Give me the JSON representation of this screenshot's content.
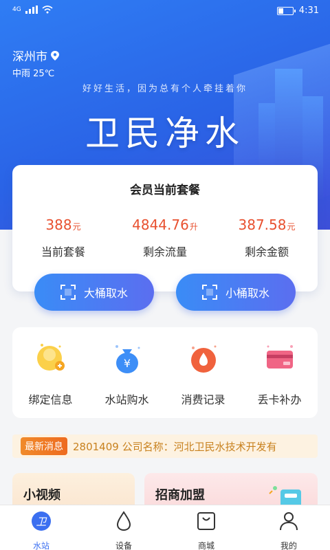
{
  "status": {
    "time": "4:31",
    "network": "4G"
  },
  "header": {
    "city": "深州市",
    "weather": "中雨 25℃",
    "slogan": "好好生活，因为总有个人牵挂着你",
    "title": "卫民净水"
  },
  "package": {
    "title": "会员当前套餐",
    "stats": [
      {
        "value": "388",
        "unit": "元",
        "label": "当前套餐"
      },
      {
        "value": "4844.76",
        "unit": "升",
        "label": "剩余流量"
      },
      {
        "value": "387.58",
        "unit": "元",
        "label": "剩余金额"
      }
    ],
    "buttons": {
      "big": "大桶取水",
      "small": "小桶取水"
    }
  },
  "menu": [
    {
      "label": "绑定信息",
      "icon": "bind-info-icon"
    },
    {
      "label": "水站购水",
      "icon": "money-bag-icon"
    },
    {
      "label": "消费记录",
      "icon": "water-drop-record-icon"
    },
    {
      "label": "丢卡补办",
      "icon": "card-icon"
    }
  ],
  "news": {
    "tag": "最新消息",
    "text": "2801409 公司名称：河北卫民水技术开发有"
  },
  "features": {
    "video": "小视频",
    "join": "招商加盟"
  },
  "tabs": [
    {
      "label": "水站",
      "icon": "water-station-icon",
      "active": true
    },
    {
      "label": "设备",
      "icon": "drop-icon",
      "active": false
    },
    {
      "label": "商城",
      "icon": "shop-bag-icon",
      "active": false
    },
    {
      "label": "我的",
      "icon": "person-icon",
      "active": false
    }
  ],
  "colors": {
    "primary": "#3b6ff0",
    "accent": "#e8502f",
    "news": "#c8811e"
  }
}
